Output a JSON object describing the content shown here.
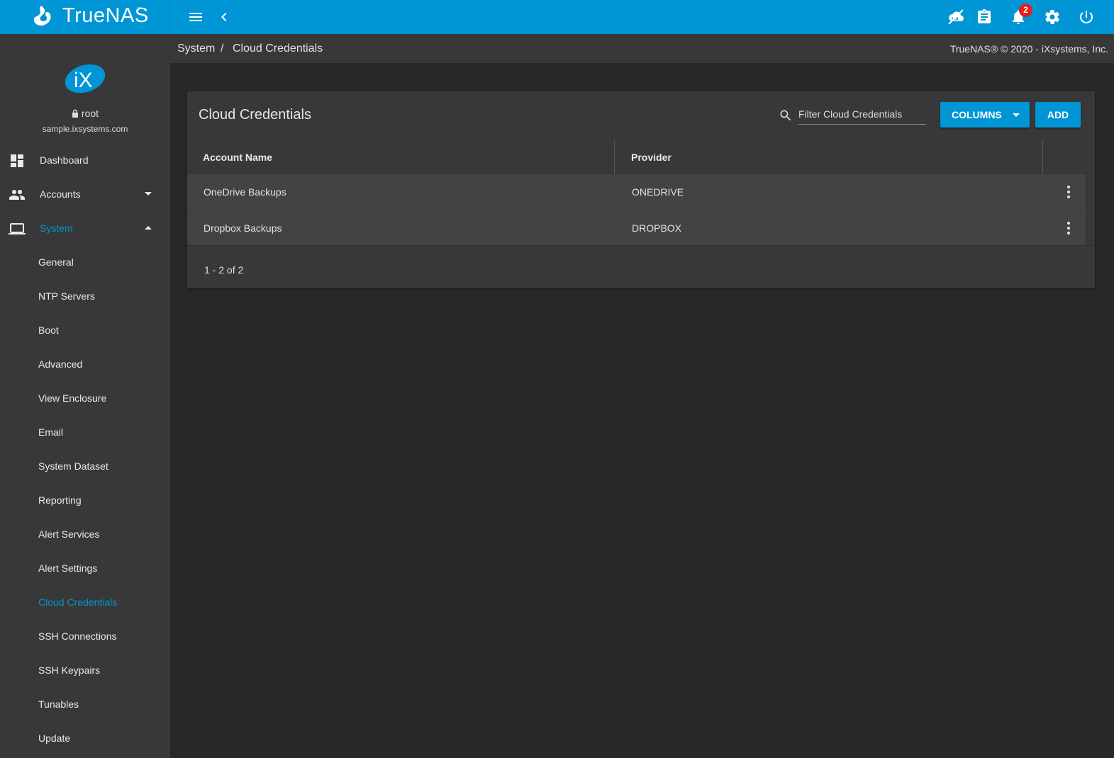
{
  "app": {
    "brand_name": "TrueNAS",
    "brand_tm": "™",
    "notification_count": "2",
    "accent_color": "#0095d5"
  },
  "sidebar": {
    "user": "root",
    "host": "sample.ixsystems.com",
    "items": [
      {
        "label": "Dashboard",
        "icon": "dashboard-icon"
      },
      {
        "label": "Accounts",
        "icon": "people-icon"
      },
      {
        "label": "System",
        "icon": "laptop-icon"
      }
    ],
    "system_subitems": [
      "General",
      "NTP Servers",
      "Boot",
      "Advanced",
      "View Enclosure",
      "Email",
      "System Dataset",
      "Reporting",
      "Alert Services",
      "Alert Settings",
      "Cloud Credentials",
      "SSH Connections",
      "SSH Keypairs",
      "Tunables",
      "Update"
    ]
  },
  "breadcrumb": {
    "parent": "System",
    "separator": "/",
    "current": "Cloud Credentials",
    "copyright": "TrueNAS® © 2020 - iXsystems, Inc."
  },
  "card": {
    "title": "Cloud Credentials",
    "filter_placeholder": "Filter Cloud Credentials",
    "columns_label": "COLUMNS",
    "add_label": "ADD",
    "headers": [
      "Account Name",
      "Provider"
    ],
    "rows": [
      {
        "account_name": "OneDrive Backups",
        "provider": "ONEDRIVE"
      },
      {
        "account_name": "Dropbox Backups",
        "provider": "DROPBOX"
      }
    ],
    "pager": "1 - 2 of 2"
  }
}
